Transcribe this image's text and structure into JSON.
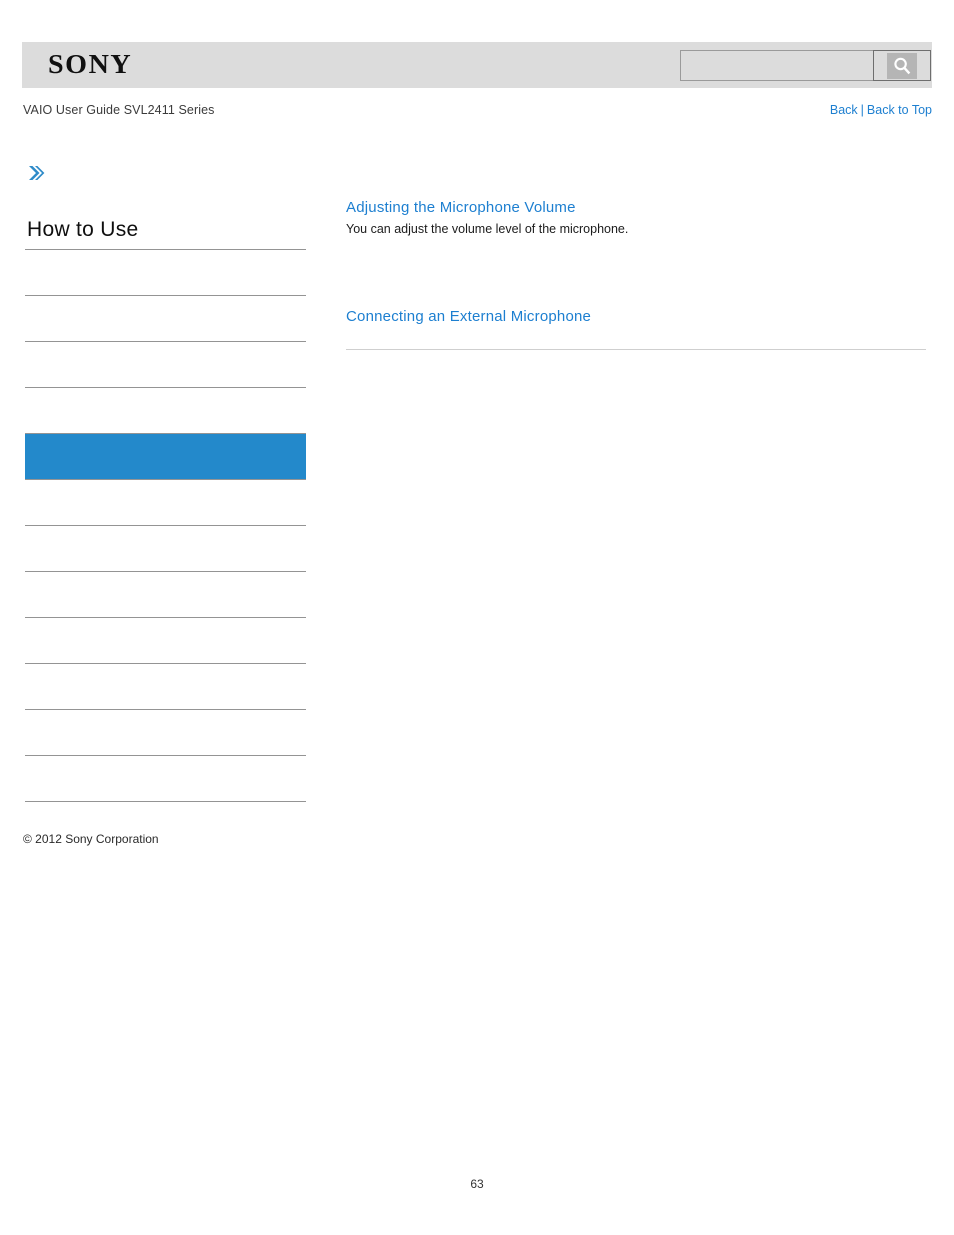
{
  "header": {
    "logo_text": "SONY",
    "logo_name": "sony-logo",
    "guide_title": "VAIO User Guide SVL2411 Series",
    "background_color": "#dcdcdc"
  },
  "search": {
    "value": "",
    "placeholder": "",
    "button_icon": "search-icon"
  },
  "nav": {
    "back_label": "Back",
    "separator": "|",
    "back_to_top_label": "Back to Top",
    "link_color": "#1d7fd0"
  },
  "sidebar": {
    "expand_icon": "double-chevron-right-icon",
    "title": "How to Use",
    "active_color": "#2389cb",
    "items": [
      {
        "label": "",
        "active": false
      },
      {
        "label": "",
        "active": false
      },
      {
        "label": "",
        "active": false
      },
      {
        "label": "",
        "active": false
      },
      {
        "label": "",
        "active": true
      },
      {
        "label": "",
        "active": false
      },
      {
        "label": "",
        "active": false
      },
      {
        "label": "",
        "active": false
      },
      {
        "label": "",
        "active": false
      },
      {
        "label": "",
        "active": false
      },
      {
        "label": "",
        "active": false
      },
      {
        "label": "",
        "active": false
      }
    ]
  },
  "main": {
    "entries": [
      {
        "link": "Adjusting the Microphone Volume",
        "description": "You can adjust the volume level of the microphone."
      },
      {
        "link": "Connecting an External Microphone",
        "description": ""
      }
    ]
  },
  "footer": {
    "copyright": "© 2012 Sony Corporation",
    "page_number": "63"
  }
}
